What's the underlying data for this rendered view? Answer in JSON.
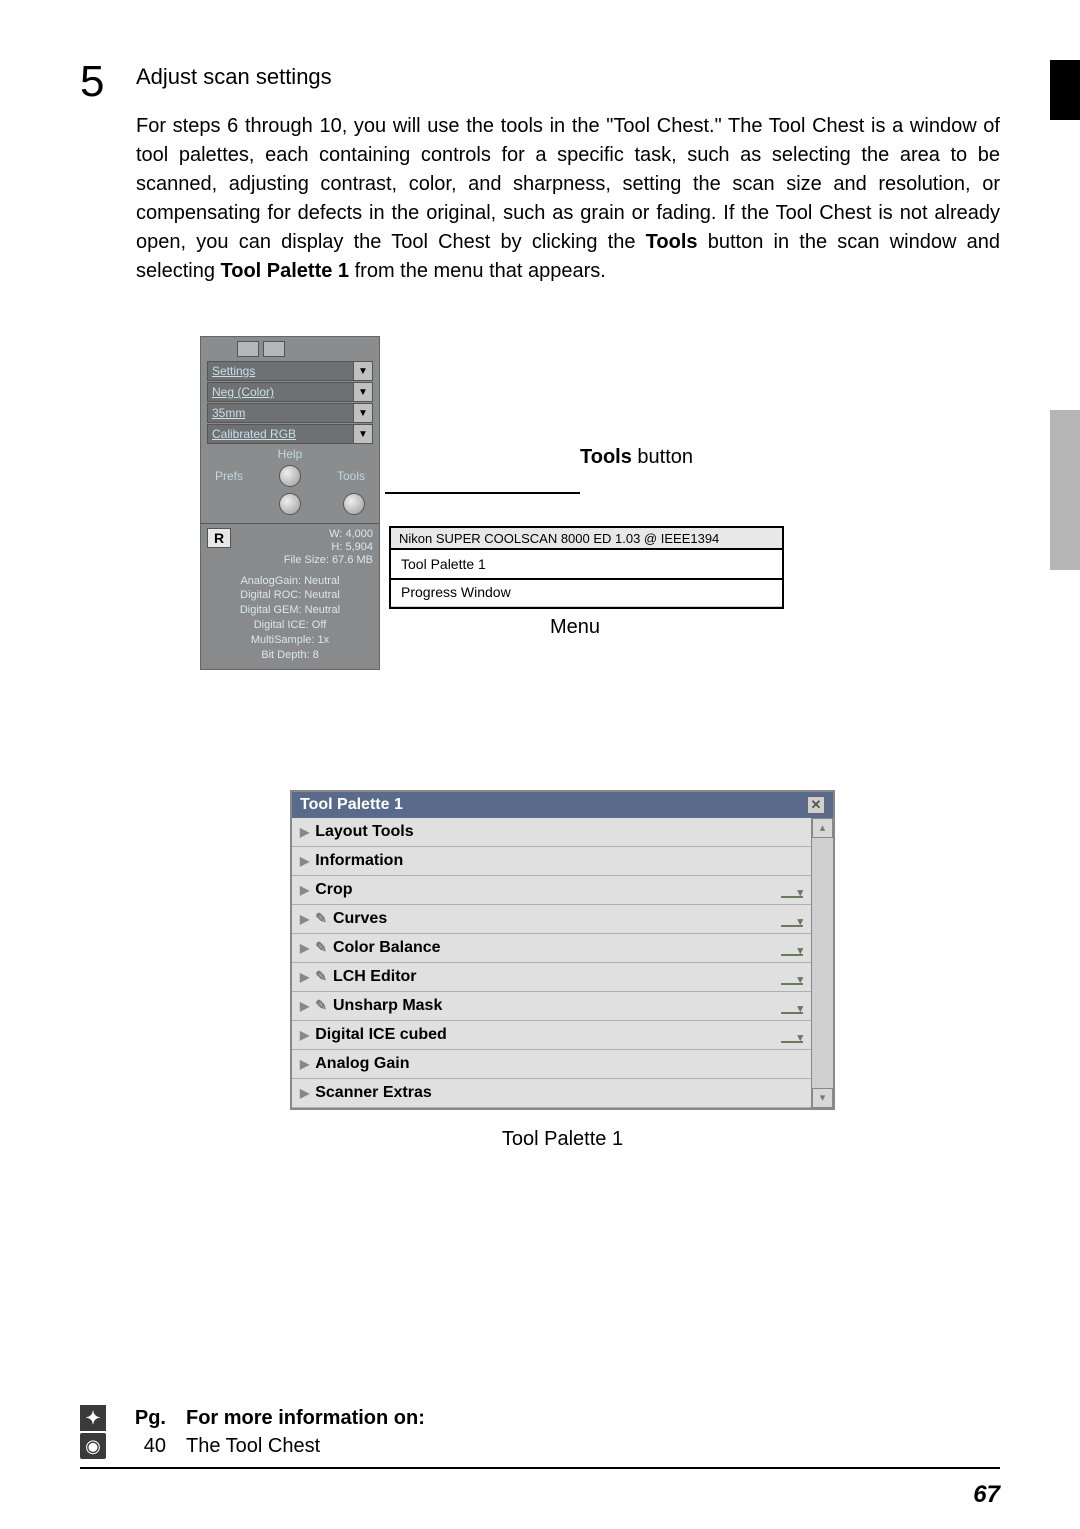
{
  "step": {
    "number": "5",
    "title": "Adjust scan settings",
    "body_pre": "For steps 6 through 10, you will use the tools in the \"Tool Chest.\"  The Tool Chest is a window of tool palettes, each containing controls for a specific task, such as selecting the area to be scanned, adjusting contrast, color, and sharpness, setting the scan size and resolution, or compensating for defects in the original, such as grain or fading.  If the Tool Chest is not already open, you can display the Tool Chest by clicking the ",
    "body_bold1": "Tools",
    "body_mid": " button in the scan window and selecting ",
    "body_bold2": "Tool Palette 1",
    "body_post": " from the menu that appears."
  },
  "scan_panel": {
    "dd": [
      "Settings",
      "Neg (Color)",
      "35mm",
      "Calibrated RGB"
    ],
    "help": "Help",
    "prefs": "Prefs",
    "tools": "Tools",
    "r": "R",
    "w": "W: 4,000",
    "h": "H: 5,904",
    "size": "File Size: 67.6 MB",
    "status": [
      "AnalogGain: Neutral",
      "Digital ROC: Neutral",
      "Digital GEM: Neutral",
      "Digital ICE: Off",
      "MultiSample: 1x",
      "Bit Depth: 8"
    ]
  },
  "callouts": {
    "tools_button_pre": "Tools",
    "tools_button_post": " button",
    "menu": "Menu"
  },
  "menu": {
    "header": "Nikon SUPER COOLSCAN 8000 ED 1.03 @ IEEE1394",
    "items": [
      "Tool Palette 1",
      "Progress Window"
    ]
  },
  "palette": {
    "title": "Tool Palette 1",
    "rows": [
      {
        "label": "Layout Tools",
        "check": false,
        "dd": false
      },
      {
        "label": "Information",
        "check": false,
        "dd": false
      },
      {
        "label": "Crop",
        "check": false,
        "dd": true
      },
      {
        "label": "Curves",
        "check": true,
        "dd": true
      },
      {
        "label": "Color Balance",
        "check": true,
        "dd": true
      },
      {
        "label": "LCH Editor",
        "check": true,
        "dd": true
      },
      {
        "label": "Unsharp Mask",
        "check": true,
        "dd": true
      },
      {
        "label": "Digital ICE cubed",
        "check": false,
        "dd": true
      },
      {
        "label": "Analog Gain",
        "check": false,
        "dd": false
      },
      {
        "label": "Scanner Extras",
        "check": false,
        "dd": false
      }
    ],
    "caption": "Tool Palette 1"
  },
  "footer": {
    "pg_header": "Pg.",
    "info_header": "For more information on:",
    "pg": "40",
    "topic": "The Tool Chest"
  },
  "page_number": "67"
}
